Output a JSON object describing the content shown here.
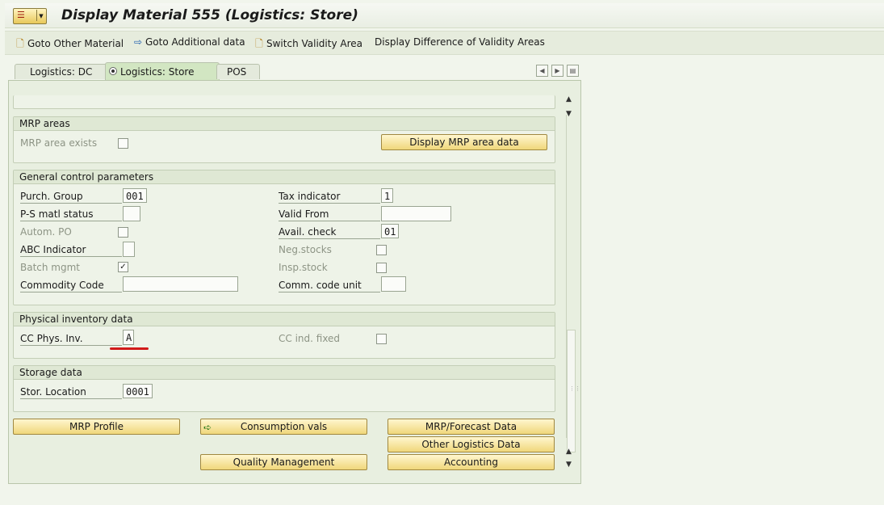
{
  "window": {
    "title": "Display Material 555 (Logistics: Store)"
  },
  "toolbar": {
    "goto_other_material": "Goto Other Material",
    "goto_additional_data": "Goto Additional data",
    "switch_validity_area": "Switch Validity Area",
    "display_difference": "Display Difference of Validity Areas"
  },
  "tabs": {
    "dc": "Logistics: DC",
    "store": "Logistics: Store",
    "pos": "POS",
    "active": "Logistics: Store"
  },
  "mrp_areas": {
    "title": "MRP areas",
    "mrp_area_exists_label": "MRP area exists",
    "mrp_area_exists_checked": false,
    "display_button": "Display MRP area data"
  },
  "general_control": {
    "title": "General control parameters",
    "purch_group_label": "Purch. Group",
    "purch_group_value": "001",
    "ps_matl_status_label": "P-S matl status",
    "ps_matl_status_value": "",
    "autom_po_label": "Autom. PO",
    "autom_po_checked": false,
    "abc_indicator_label": "ABC Indicator",
    "abc_indicator_value": "",
    "batch_mgmt_label": "Batch mgmt",
    "batch_mgmt_checked": true,
    "commodity_code_label": "Commodity Code",
    "commodity_code_value": "",
    "tax_indicator_label": "Tax indicator",
    "tax_indicator_value": "1",
    "valid_from_label": "Valid From",
    "valid_from_value": "",
    "avail_check_label": "Avail. check",
    "avail_check_value": "01",
    "neg_stocks_label": "Neg.stocks",
    "neg_stocks_checked": false,
    "insp_stock_label": "Insp.stock",
    "insp_stock_checked": false,
    "comm_code_unit_label": "Comm. code unit",
    "comm_code_unit_value": ""
  },
  "physical_inventory": {
    "title": "Physical inventory data",
    "cc_phys_inv_label": "CC Phys. Inv.",
    "cc_phys_inv_value": "A",
    "cc_ind_fixed_label": "CC ind. fixed",
    "cc_ind_fixed_checked": false
  },
  "storage": {
    "title": "Storage data",
    "stor_location_label": "Stor. Location",
    "stor_location_value": "0001"
  },
  "bottom_buttons": {
    "mrp_profile": "MRP Profile",
    "consumption_vals": "Consumption vals",
    "mrp_forecast": "MRP/Forecast Data",
    "other_logistics": "Other Logistics Data",
    "quality_management": "Quality Management",
    "accounting": "Accounting"
  },
  "colors": {
    "background": "#f1f5ec",
    "button_fill": "#f0d77b",
    "highlight_underline": "#d11a1a"
  }
}
